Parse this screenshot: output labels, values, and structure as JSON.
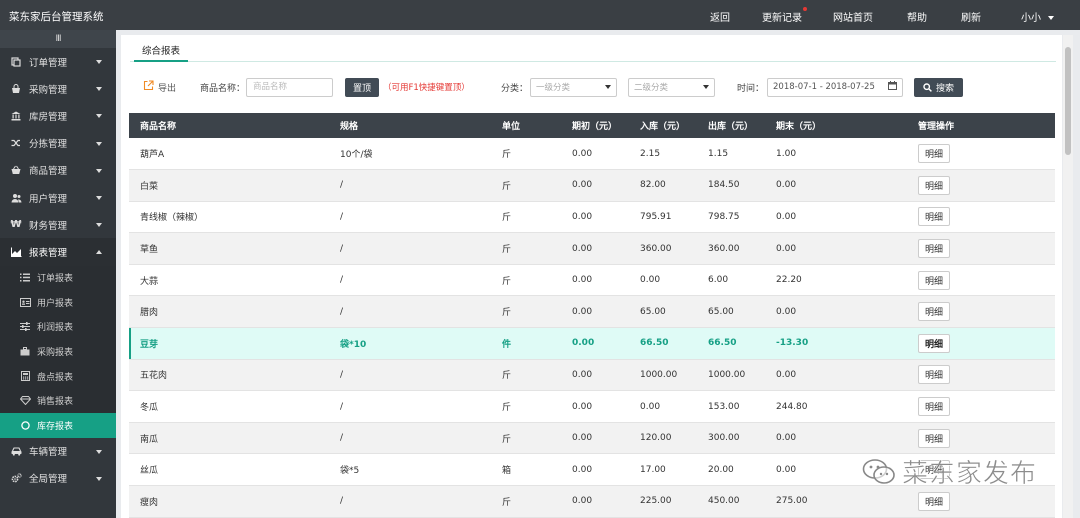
{
  "app": {
    "title": "菜东家后台管理系统"
  },
  "topnav": {
    "items": [
      "返回",
      "更新记录",
      "网站首页",
      "帮助",
      "刷新"
    ],
    "user": "小小"
  },
  "sidebar": {
    "toggle": "III",
    "items": [
      {
        "label": "订单管理",
        "icon": "copy-icon"
      },
      {
        "label": "采购管理",
        "icon": "bag-icon"
      },
      {
        "label": "库房管理",
        "icon": "bank-icon"
      },
      {
        "label": "分拣管理",
        "icon": "shuffle-icon"
      },
      {
        "label": "商品管理",
        "icon": "basket-icon"
      },
      {
        "label": "用户管理",
        "icon": "users-icon"
      },
      {
        "label": "财务管理",
        "icon": "won-icon"
      },
      {
        "label": "报表管理",
        "icon": "area-chart-icon"
      }
    ],
    "subitems": [
      {
        "label": "订单报表",
        "icon": "list-icon"
      },
      {
        "label": "用户报表",
        "icon": "id-card-icon"
      },
      {
        "label": "利润报表",
        "icon": "sliders-icon"
      },
      {
        "label": "采购报表",
        "icon": "briefcase-icon"
      },
      {
        "label": "盘点报表",
        "icon": "calculator-icon"
      },
      {
        "label": "销售报表",
        "icon": "diamond-icon"
      },
      {
        "label": "库存报表",
        "icon": "circle-o-icon"
      }
    ],
    "bottom_items": [
      {
        "label": "车辆管理",
        "icon": "car-icon"
      },
      {
        "label": "全局管理",
        "icon": "cogs-icon"
      }
    ]
  },
  "tabs": [
    "综合报表"
  ],
  "toolbar": {
    "export_label": "导出",
    "name_label": "商品名称：",
    "name_placeholder": "商品名称",
    "pin_label": "置顶",
    "pin_hint": "（可用F1快捷键置顶）",
    "category_label": "分类：",
    "category1_placeholder": "一级分类",
    "category2_placeholder": "二级分类",
    "time_label": "时间：",
    "date_range": "2018-07-1 - 2018-07-25",
    "search_label": "搜索"
  },
  "table": {
    "headers": [
      "商品名称",
      "规格",
      "单位",
      "期初（元）",
      "入库（元）",
      "出库（元）",
      "期末（元）",
      "管理操作"
    ],
    "detail_label": "明细",
    "rows": [
      [
        "葫芦A",
        "10个/袋",
        "斤",
        "0.00",
        "2.15",
        "1.15",
        "1.00"
      ],
      [
        "白菜",
        "/",
        "斤",
        "0.00",
        "82.00",
        "184.50",
        "0.00"
      ],
      [
        "青线椒（辣椒）",
        "/",
        "斤",
        "0.00",
        "795.91",
        "798.75",
        "0.00"
      ],
      [
        "草鱼",
        "/",
        "斤",
        "0.00",
        "360.00",
        "360.00",
        "0.00"
      ],
      [
        "大蒜",
        "/",
        "斤",
        "0.00",
        "0.00",
        "6.00",
        "22.20"
      ],
      [
        "腊肉",
        "/",
        "斤",
        "0.00",
        "65.00",
        "65.00",
        "0.00"
      ],
      [
        "豆芽",
        "袋*10",
        "件",
        "0.00",
        "66.50",
        "66.50",
        "-13.30"
      ],
      [
        "五花肉",
        "/",
        "斤",
        "0.00",
        "1000.00",
        "1000.00",
        "0.00"
      ],
      [
        "冬瓜",
        "/",
        "斤",
        "0.00",
        "0.00",
        "153.00",
        "244.80"
      ],
      [
        "南瓜",
        "/",
        "斤",
        "0.00",
        "120.00",
        "300.00",
        "0.00"
      ],
      [
        "丝瓜",
        "袋*5",
        "箱",
        "0.00",
        "17.00",
        "20.00",
        "0.00"
      ],
      [
        "瘦肉",
        "/",
        "斤",
        "0.00",
        "225.00",
        "450.00",
        "275.00"
      ]
    ],
    "highlight_row": 6
  },
  "watermark": {
    "text": "菜东家发布"
  },
  "colors": {
    "accent": "#16a085",
    "topbar": "#3a3f44",
    "sidebar": "#32373c",
    "table_header": "#3c434a",
    "hint": "#e53935"
  }
}
